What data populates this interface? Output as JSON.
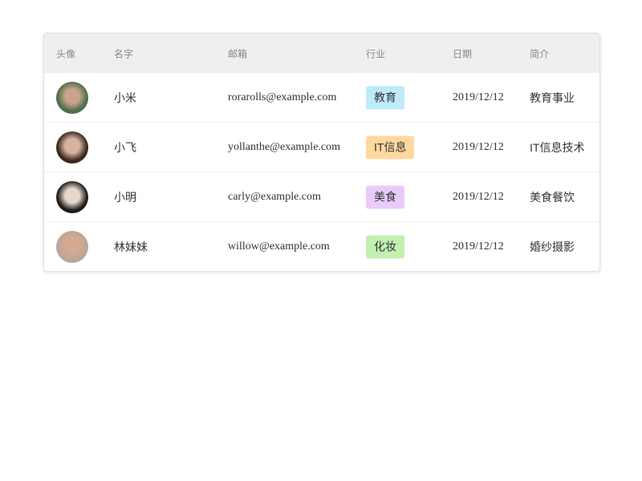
{
  "table": {
    "headers": [
      "头像",
      "名字",
      "邮箱",
      "行业",
      "日期",
      "简介"
    ],
    "rows": [
      {
        "name": "小米",
        "email": "rorarolls@example.com",
        "industry": "教育",
        "industry_color": "#bfeafc",
        "date": "2019/12/12",
        "intro": "教育事业",
        "avatar_colors": [
          "#4e6e4a",
          "#c9a38a"
        ]
      },
      {
        "name": "小飞",
        "email": "yollanthe@example.com",
        "industry": "IT信息",
        "industry_color": "#ffd89e",
        "date": "2019/12/12",
        "intro": "IT信息技术",
        "avatar_colors": [
          "#3a2720",
          "#d7b3a0"
        ]
      },
      {
        "name": "小明",
        "email": "carly@example.com",
        "industry": "美食",
        "industry_color": "#e8cbfb",
        "date": "2019/12/12",
        "intro": "美食餐饮",
        "avatar_colors": [
          "#1f1a1a",
          "#e8d8cc"
        ]
      },
      {
        "name": "林妹妹",
        "email": "willow@example.com",
        "industry": "化妆",
        "industry_color": "#c1f0b0",
        "date": "2019/12/12",
        "intro": "婚纱摄影",
        "avatar_colors": [
          "#b9a69a",
          "#d7a990"
        ]
      }
    ]
  }
}
